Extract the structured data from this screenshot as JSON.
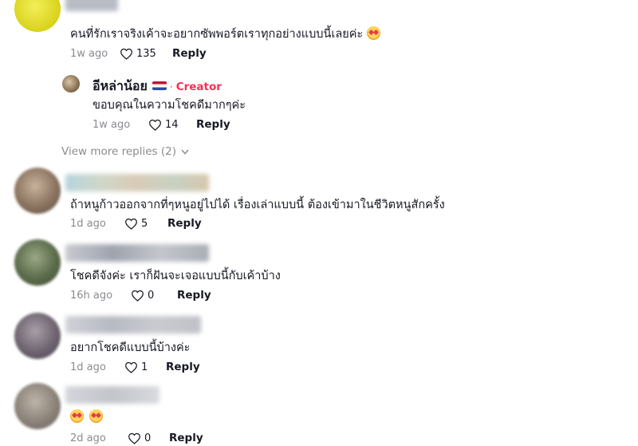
{
  "comments": [
    {
      "text": "คนที่รักเราจริงเค้าจะอยากซัพพอร์ตเราทุกอย่างแบบนี้เลยค่ะ",
      "time": "1w ago",
      "likes": "135",
      "reply": "Reply",
      "avatar_color": "#e8e22a"
    },
    {
      "text": "ถ้าหนูก้าวออกจากที่ๆหนูอยู่ไปได้ เรื่องเล่าแบบนี้ ต้องเข้ามาในชีวิตหนูสักครั้ง",
      "time": "1d ago",
      "likes": "5",
      "reply": "Reply",
      "avatar_color": "#8a7460"
    },
    {
      "text": "โชคดีจังค่ะ เราก็ฝันจะเจอแบบนี้กับเค้าบ้าง",
      "time": "16h ago",
      "likes": "0",
      "reply": "Reply",
      "avatar_color": "#5b6b4a"
    },
    {
      "text": "อยากโชคดีแบบนี้บ้างค่ะ",
      "time": "1d ago",
      "likes": "1",
      "reply": "Reply",
      "avatar_color": "#6e6470"
    },
    {
      "text": "",
      "time": "2d ago",
      "likes": "0",
      "reply": "Reply",
      "avatar_color": "#8b8379"
    }
  ],
  "creator_reply": {
    "name": "อีหล่าน้อย",
    "badge": "Creator",
    "separator": "·",
    "text": "ขอบคุณในความโชคดีมากๆค่ะ",
    "time": "1w ago",
    "likes": "14",
    "reply": "Reply"
  },
  "view_more": "View more replies (2)",
  "colors": {
    "accent": "#fe2c55",
    "muted": "#8a8b91",
    "text": "#161823"
  },
  "icons": {
    "like": "heart-outline-icon",
    "expand": "chevron-down-icon",
    "emoji": "smiling-face-with-heart-eyes-emoji"
  }
}
